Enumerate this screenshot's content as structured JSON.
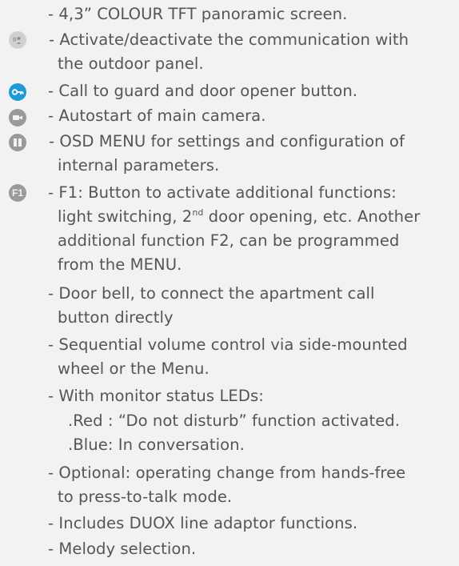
{
  "features": [
    {
      "icon": null,
      "lines": [
        "- 4,3” COLOUR TFT panoramic screen."
      ]
    },
    {
      "icon": "talk-icon",
      "lines": [
        "- Activate/deactivate the communication with",
        "the outdoor panel."
      ]
    },
    {
      "icon": "key-icon",
      "lines": [
        "- Call to guard and door opener button."
      ]
    },
    {
      "icon": "camera-icon",
      "lines": [
        "- Autostart of main camera."
      ]
    },
    {
      "icon": "menu-icon",
      "lines": [
        "- OSD MENU for settings and configuration of",
        "internal parameters."
      ]
    },
    {
      "icon": "f1-icon",
      "icon_label": "F1",
      "lines": [
        "- F1: Button to activate additional functions:",
        "light switching, 2",
        "nd",
        " door opening, etc. Another",
        "additional function F2, can be programmed",
        "from the MENU."
      ]
    },
    {
      "icon": null,
      "lines": [
        "- Door bell, to connect the apartment call",
        "button directly"
      ]
    },
    {
      "icon": null,
      "lines": [
        "- Sequential volume control via side-mounted",
        "wheel or the Menu."
      ]
    },
    {
      "icon": null,
      "lines": [
        "- With monitor status LEDs:",
        ".Red : “Do not disturb” function activated.",
        ".Blue: In conversation."
      ]
    },
    {
      "icon": null,
      "lines": [
        "- Optional: operating change from hands-free",
        "to press-to-talk mode."
      ]
    },
    {
      "icon": null,
      "lines": [
        "-  Includes DUOX line adaptor functions."
      ]
    },
    {
      "icon": null,
      "lines": [
        "- Melody selection."
      ]
    }
  ],
  "colors": {
    "text": "#555555",
    "background": "#f2f2f2",
    "key_icon": "#1e9bd7",
    "gray_icon": "#9a9a9a",
    "talk_icon": "#cfcfcf"
  }
}
